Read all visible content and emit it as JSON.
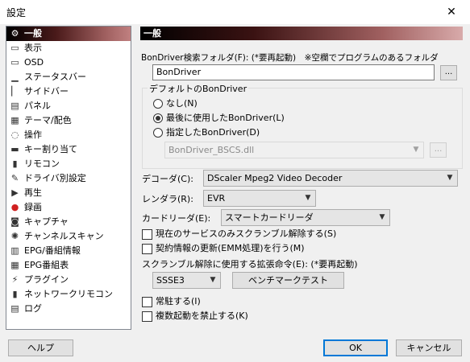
{
  "window": {
    "title": "設定",
    "close_glyph": "✕"
  },
  "sidebar": {
    "items": [
      {
        "label": "一般",
        "icon": "gear-icon",
        "glyph": "⚙"
      },
      {
        "label": "表示",
        "icon": "display-icon",
        "glyph": "▭"
      },
      {
        "label": "OSD",
        "icon": "monitor-icon",
        "glyph": "▭"
      },
      {
        "label": "ステータスバー",
        "icon": "statusbar-icon",
        "glyph": "▁"
      },
      {
        "label": "サイドバー",
        "icon": "sidebar-icon",
        "glyph": "▏"
      },
      {
        "label": "パネル",
        "icon": "panel-icon",
        "glyph": "▤"
      },
      {
        "label": "テーマ/配色",
        "icon": "palette-icon",
        "glyph": "▦"
      },
      {
        "label": "操作",
        "icon": "mouse-icon",
        "glyph": "◌"
      },
      {
        "label": "キー割り当て",
        "icon": "keyboard-icon",
        "glyph": "▬"
      },
      {
        "label": "リモコン",
        "icon": "remote-icon",
        "glyph": "▮"
      },
      {
        "label": "ドライバ別設定",
        "icon": "driver-icon",
        "glyph": "✎"
      },
      {
        "label": "再生",
        "icon": "play-icon",
        "glyph": "▶"
      },
      {
        "label": "録画",
        "icon": "record-icon",
        "glyph": "●"
      },
      {
        "label": "キャプチャ",
        "icon": "camera-icon",
        "glyph": "◙"
      },
      {
        "label": "チャンネルスキャン",
        "icon": "scan-icon",
        "glyph": "✺"
      },
      {
        "label": "EPG/番組情報",
        "icon": "epg-info-icon",
        "glyph": "▥"
      },
      {
        "label": "EPG番組表",
        "icon": "epg-table-icon",
        "glyph": "▦"
      },
      {
        "label": "プラグイン",
        "icon": "plug-icon",
        "glyph": "⚡"
      },
      {
        "label": "ネットワークリモコン",
        "icon": "network-remote-icon",
        "glyph": "▮"
      },
      {
        "label": "ログ",
        "icon": "log-icon",
        "glyph": "▤"
      }
    ]
  },
  "panel": {
    "header": "一般",
    "bondriver_folder_label": "BonDriver検索フォルダ(F): (*要再起動)　※空欄でプログラムのあるフォルダ",
    "bondriver_folder_value": "BonDriver",
    "browse_label": "...",
    "default_bondriver_group": "デフォルトのBonDriver",
    "radio_none": "なし(N)",
    "radio_last_used": "最後に使用したBonDriver(L)",
    "radio_specified": "指定したBonDriver(D)",
    "specified_value": "BonDriver_BSCS.dll",
    "specified_browse_label": "...",
    "decoder_label": "デコーダ(C):",
    "decoder_value": "DScaler Mpeg2 Video Decoder",
    "renderer_label": "レンダラ(R):",
    "renderer_value": "EVR",
    "card_reader_label": "カードリーダ(E):",
    "card_reader_value": "スマートカードリーダ",
    "check_descramble_current": "現在のサービスのみスクランブル解除する(S)",
    "check_emm_update": "契約情報の更新(EMM処理)を行う(M)",
    "instruction_label": "スクランブル解除に使用する拡張命令(E): (*要再起動)",
    "instruction_value": "SSSE3",
    "benchmark_label": "ベンチマークテスト",
    "check_resident": "常駐する(I)",
    "check_no_multi": "複数起動を禁止する(K)"
  },
  "footer": {
    "help_label": "ヘルプ",
    "ok_label": "OK",
    "cancel_label": "キャンセル"
  },
  "state": {
    "selected_sidebar_index": 0,
    "selected_radio": "last_used"
  }
}
